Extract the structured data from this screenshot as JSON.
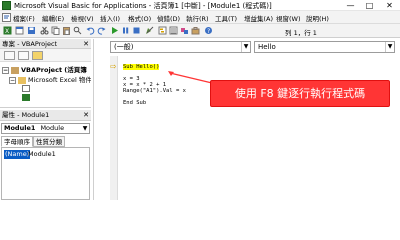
{
  "titlebar": {
    "title": "Microsoft Visual Basic for Applications - 活頁簿1 [中斷] - [Module1 (程式碼)]",
    "minimize": "—",
    "restore": "□",
    "close": "✕"
  },
  "menubar": {
    "items": [
      "檔案(F)",
      "編輯(E)",
      "檢視(V)",
      "插入(I)",
      "格式(O)",
      "偵錯(D)",
      "執行(R)",
      "工具(T)",
      "增益集(A)",
      "視窗(W)",
      "說明(H)"
    ]
  },
  "toolbar": {
    "status": "列 1，行 1"
  },
  "project": {
    "header": "專案 - VBAProject",
    "tree": [
      {
        "label": "VBAProject (活頁簿",
        "bold": true
      },
      {
        "label": "Microsoft Excel 物件",
        "bold": false
      }
    ]
  },
  "properties": {
    "header": "屬性 - Module1",
    "combo_name": "Module1",
    "combo_type": "Module",
    "tabs": [
      "字母順序",
      "性質分類"
    ],
    "row_name": "(Name)",
    "row_value": "Module1"
  },
  "code": {
    "object_combo": "(一般)",
    "proc_combo": "Hello",
    "lines": [
      "Sub Hello()",
      "",
      "x = 3",
      "x = x * 2 + 1",
      "Range(\"A1\").Val = x",
      "",
      "End Sub"
    ]
  },
  "callout": {
    "text": "使用 F8 鍵逐行執行程式碼"
  },
  "colors": {
    "callout": "#ff3535",
    "exec_highlight": "#ffff00",
    "selection": "#0a5cc4"
  }
}
